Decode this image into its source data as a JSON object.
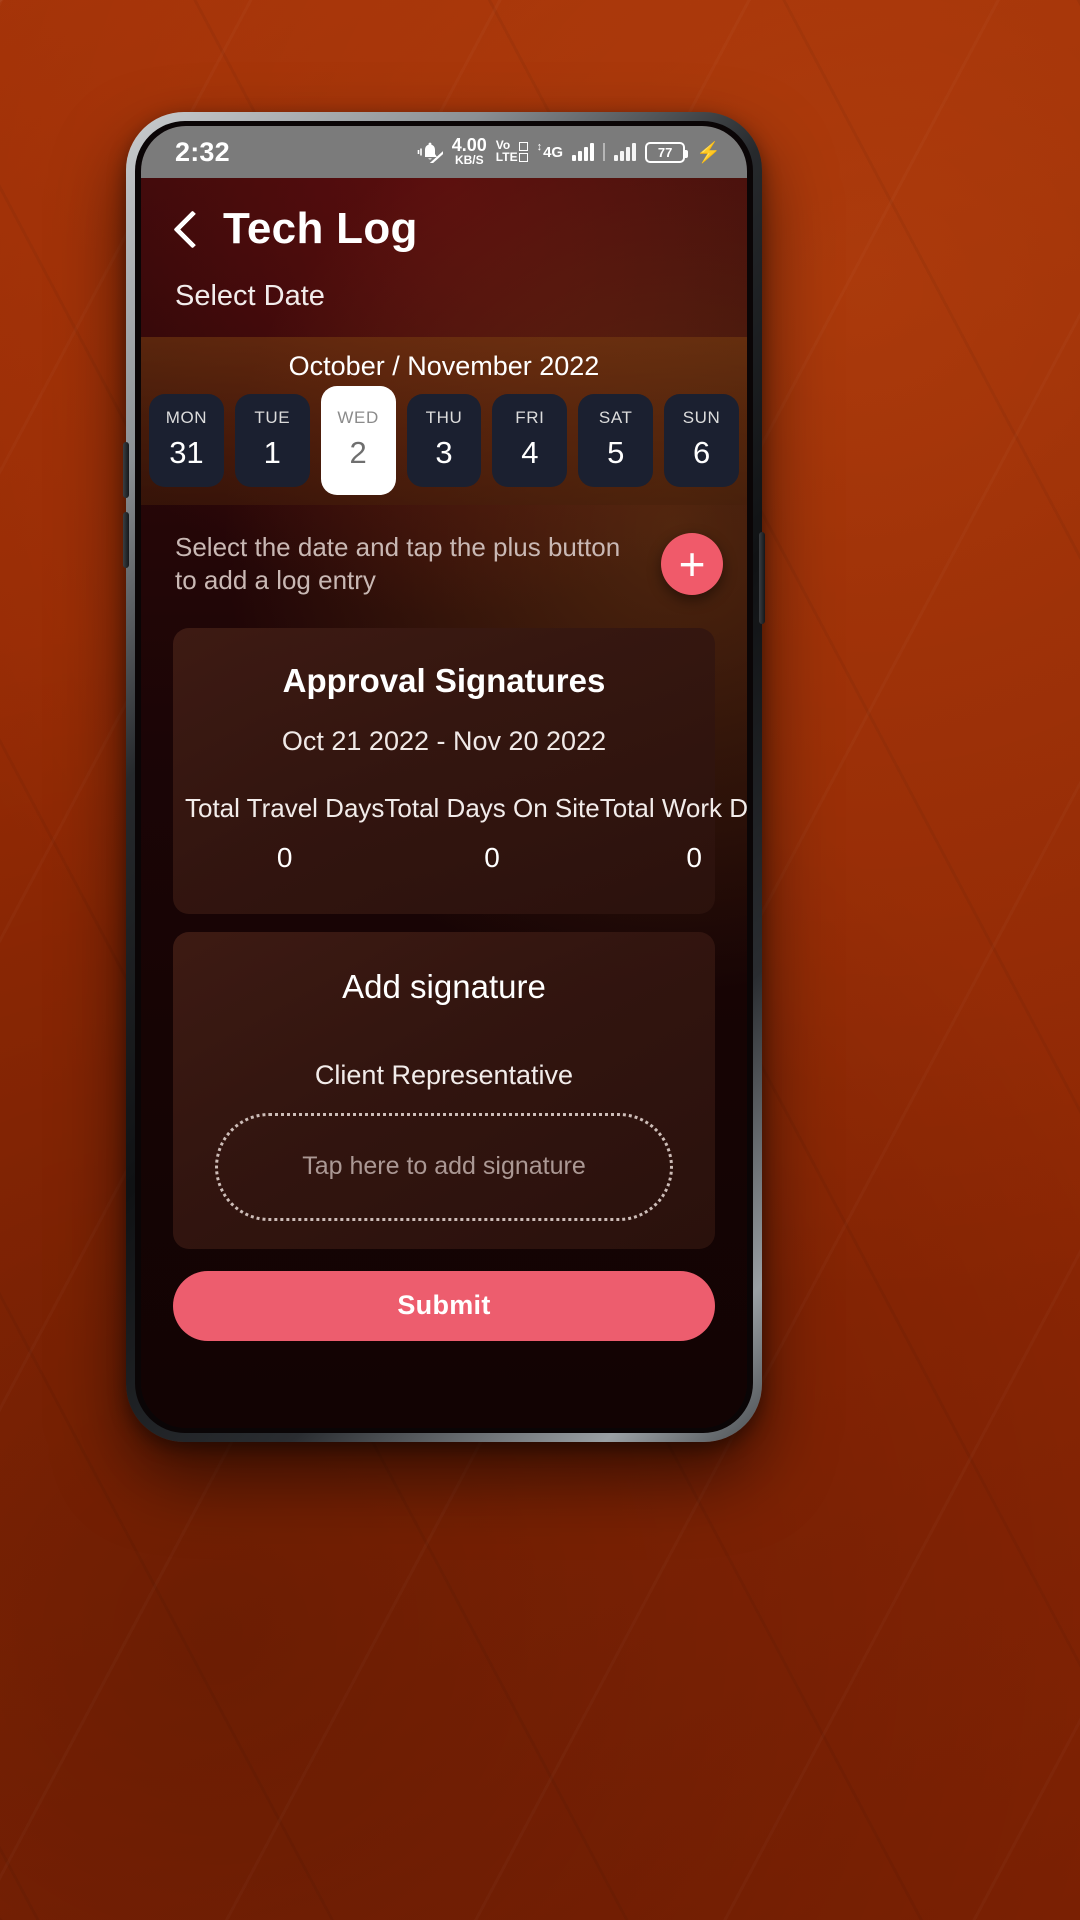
{
  "status_bar": {
    "time": "2:32",
    "mute_icon": "bell-muted-icon",
    "network_speed_value": "4.00",
    "network_speed_unit": "KB/S",
    "volte_label": "Vo",
    "volte_label2": "LTE",
    "network_type": "4G",
    "battery_percent": "77",
    "charging_icon": "lightning-bolt-icon"
  },
  "header": {
    "back_icon": "back-chevron-icon",
    "title": "Tech Log",
    "select_date_label": "Select Date"
  },
  "calendar": {
    "month_label": "October / November 2022",
    "days": [
      {
        "dow": "MON",
        "num": "31",
        "selected": false
      },
      {
        "dow": "TUE",
        "num": "1",
        "selected": false
      },
      {
        "dow": "WED",
        "num": "2",
        "selected": true
      },
      {
        "dow": "THU",
        "num": "3",
        "selected": false
      },
      {
        "dow": "FRI",
        "num": "4",
        "selected": false
      },
      {
        "dow": "SAT",
        "num": "5",
        "selected": false
      },
      {
        "dow": "SUN",
        "num": "6",
        "selected": false
      }
    ]
  },
  "hint": {
    "text": "Select the date and tap the plus button to add a log entry",
    "fab_icon": "plus-icon"
  },
  "approval": {
    "title": "Approval Signatures",
    "date_range": "Oct 21 2022 - Nov 20 2022",
    "stats": [
      {
        "label": "Total Travel Days",
        "value": "0"
      },
      {
        "label": "Total Days On Site",
        "value": "0"
      },
      {
        "label": "Total Work Days",
        "value": "0"
      }
    ]
  },
  "signature": {
    "title": "Add signature",
    "role_label": "Client Representative",
    "placeholder": "Tap here to add signature"
  },
  "submit": {
    "label": "Submit"
  },
  "colors": {
    "accent": "#ed5d6e",
    "fab": "#f05a6a",
    "app_bg": "#1b0506",
    "card_bg": "#3a1812",
    "status_bar_bg": "#7b7b7b",
    "selected_chip": "#ffffff",
    "chip_bg": "#1b2030",
    "backdrop": "#9e2f06"
  }
}
